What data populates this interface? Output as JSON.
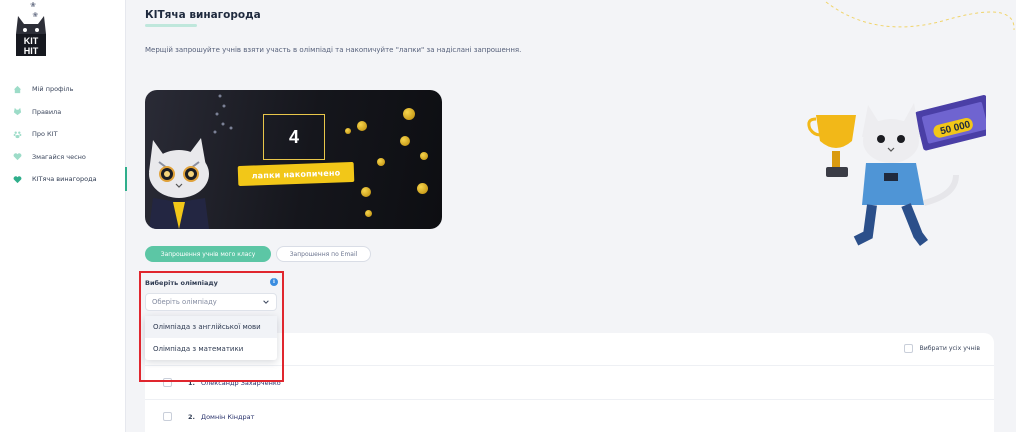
{
  "logo": {
    "line1": "KIT",
    "line2": "HIT"
  },
  "sidebar": {
    "items": [
      {
        "label": "Мій профіль",
        "icon": "home-icon"
      },
      {
        "label": "Правила",
        "icon": "rules-icon"
      },
      {
        "label": "Про КІТ",
        "icon": "paw-icon"
      },
      {
        "label": "Змагайся чесно",
        "icon": "heart-icon"
      },
      {
        "label": "КІТяча винагорода",
        "icon": "heart-active-icon"
      }
    ],
    "active_index": 4
  },
  "main": {
    "title": "КІТяча винагорода",
    "description": "Мерщій запрошуйте учнів взяти участь в олімпіаді та накопичуйте \"лапки\" за надіслані запрошення."
  },
  "banner": {
    "count": "4",
    "ribbon_text": "лапки накопичено"
  },
  "tabs": [
    {
      "label": "Запрошення учнів мого класу",
      "active": true
    },
    {
      "label": "Запрошення по Email",
      "active": false
    }
  ],
  "olympiad_select": {
    "label": "Виберіть олімпіаду",
    "placeholder": "Оберіть олімпіаду",
    "options": [
      "Олімпіада з англійської мови",
      "Олімпіада з математики"
    ]
  },
  "students": {
    "select_all_label": "Вибрати усіх учнів",
    "rows": [
      {
        "num": "1.",
        "name": "Олександр Захарченко"
      },
      {
        "num": "2.",
        "name": "Домнін Кіндрат"
      }
    ]
  },
  "hero_card_value": "50 000",
  "colors": {
    "accent": "#5cc6a5",
    "active_indicator": "#2fae8b",
    "highlight_border": "#e0262e",
    "coin_gold": "#f2c718",
    "info_blue": "#3a8de0"
  }
}
